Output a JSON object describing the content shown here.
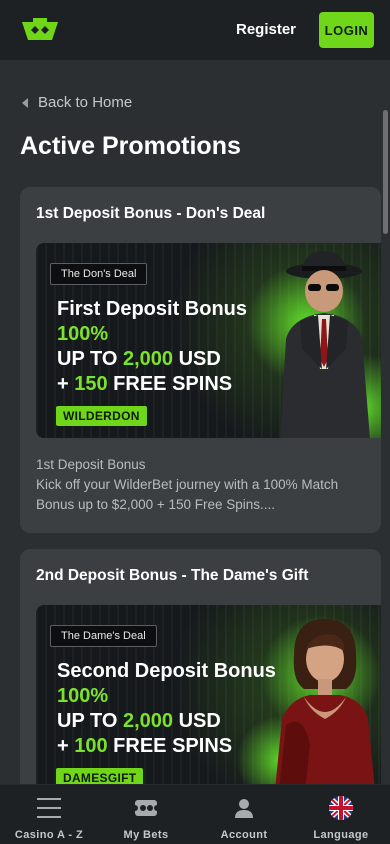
{
  "header": {
    "register_label": "Register",
    "login_label": "LOGIN",
    "logo_icon": "wilderbet-logo-icon"
  },
  "nav": {
    "back_label": "Back to Home"
  },
  "page": {
    "title": "Active Promotions"
  },
  "promotions": [
    {
      "card_title": "1st Deposit Bonus - Don's Deal",
      "banner": {
        "tag": "The Don's Deal",
        "line1": "First Deposit Bonus",
        "line2": "100%",
        "line3_prefix": "UP TO ",
        "line3_amount": "2,000",
        "line3_suffix": " USD",
        "line4_prefix": "+ ",
        "line4_amount": "150",
        "line4_suffix": " FREE SPINS",
        "code": "WILDERDON"
      },
      "description": {
        "line1": "1st Deposit Bonus",
        "line2": "Kick off your WilderBet journey with a 100% Match",
        "line3": "Bonus up to $2,000 + 150 Free Spins...."
      }
    },
    {
      "card_title": "2nd Deposit Bonus - The Dame's Gift",
      "banner": {
        "tag": "The Dame's Deal",
        "line1": "Second Deposit Bonus",
        "line2": "100%",
        "line3_prefix": "UP TO ",
        "line3_amount": "2,000",
        "line3_suffix": " USD",
        "line4_prefix": "+ ",
        "line4_amount": "100",
        "line4_suffix": " FREE SPINS",
        "code": "DAMESGIFT"
      }
    }
  ],
  "bottom_nav": [
    {
      "label": "Casino A - Z",
      "icon": "menu-icon"
    },
    {
      "label": "My Bets",
      "icon": "ticket-icon"
    },
    {
      "label": "Account",
      "icon": "user-icon"
    },
    {
      "label": "Language",
      "icon": "uk-flag-icon"
    }
  ],
  "colors": {
    "accent": "#6fd61a",
    "background": "#2c2f31",
    "card": "#3c3f42",
    "header": "#1e2123"
  }
}
